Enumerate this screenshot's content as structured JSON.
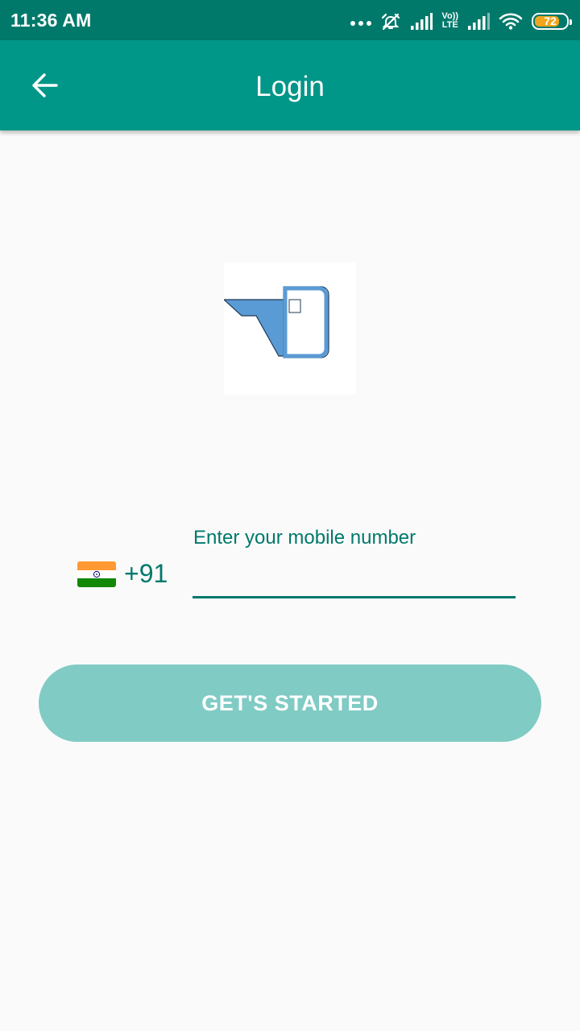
{
  "status_bar": {
    "time": "11:36 AM",
    "volte_top": "Vo))",
    "volte_bottom": "LTE",
    "battery": "72"
  },
  "app_bar": {
    "title": "Login",
    "back_icon": "arrow-left-icon"
  },
  "logo": {
    "icon": "app-logo"
  },
  "phone": {
    "flag_icon": "india-flag-icon",
    "dial_code": "+91",
    "label": "Enter your mobile number",
    "value": ""
  },
  "cta": {
    "label": "GET'S STARTED"
  },
  "colors": {
    "status_bar": "#00796b",
    "app_bar": "#009688",
    "accent": "#00796b",
    "button": "#80cbc4",
    "battery": "#f0a51c",
    "logo_blue": "#5b9bd5"
  }
}
